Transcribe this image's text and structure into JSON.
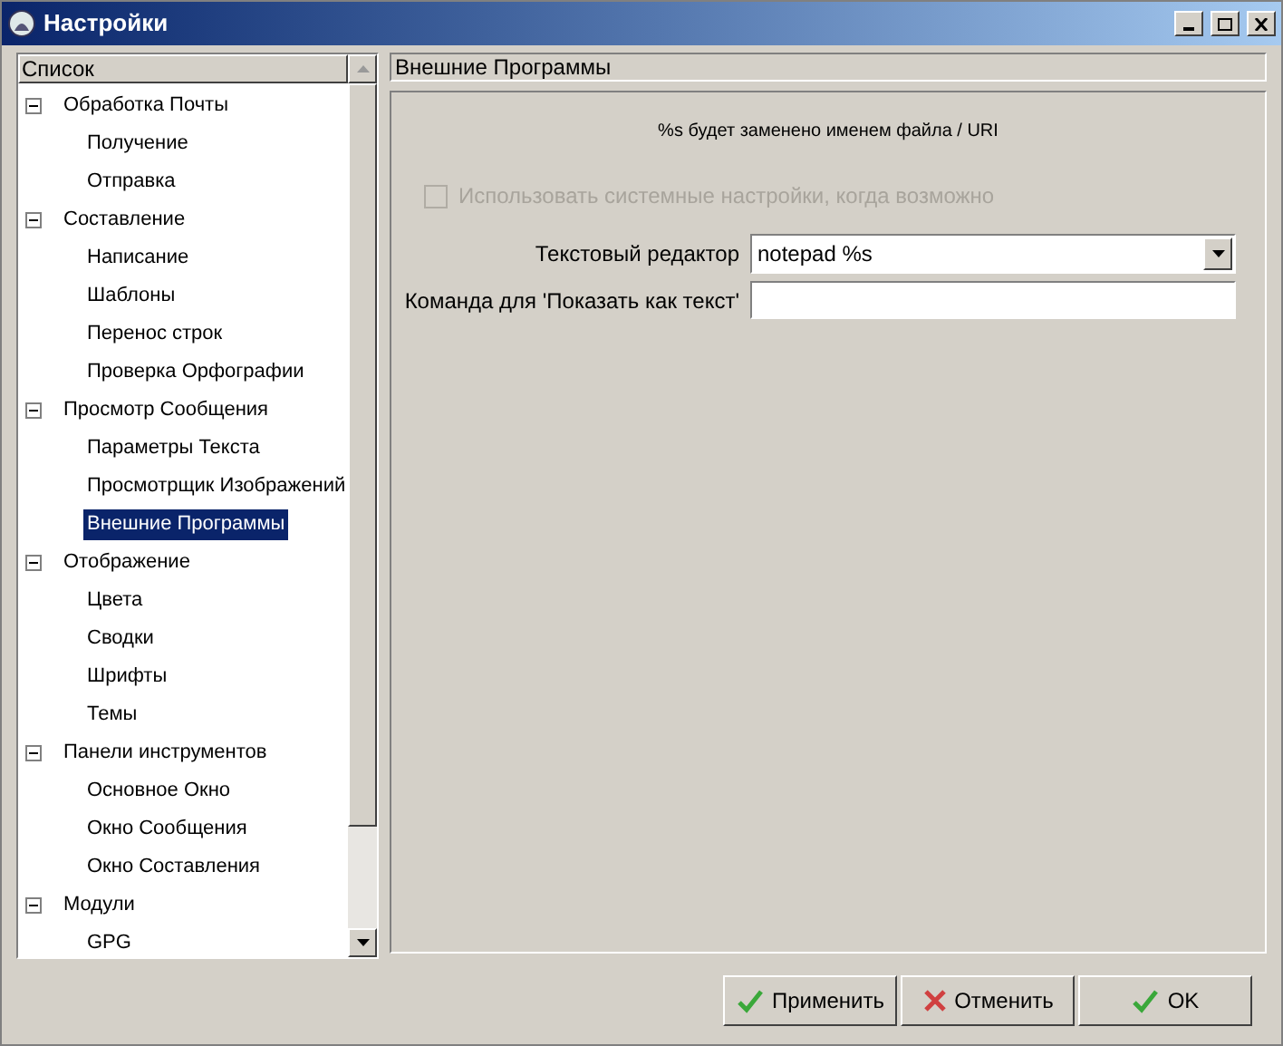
{
  "window": {
    "title": "Настройки"
  },
  "tree": {
    "header": "Список",
    "items": [
      {
        "label": "Обработка Почты",
        "expanded": true,
        "selected": false,
        "children": [
          {
            "label": "Получение",
            "selected": false
          },
          {
            "label": "Отправка",
            "selected": false
          }
        ]
      },
      {
        "label": "Составление",
        "expanded": true,
        "selected": false,
        "children": [
          {
            "label": "Написание",
            "selected": false
          },
          {
            "label": "Шаблоны",
            "selected": false
          },
          {
            "label": "Перенос строк",
            "selected": false
          },
          {
            "label": "Проверка Орфографии",
            "selected": false
          }
        ]
      },
      {
        "label": "Просмотр Сообщения",
        "expanded": true,
        "selected": false,
        "children": [
          {
            "label": "Параметры Текста",
            "selected": false
          },
          {
            "label": "Просмотрщик Изображений",
            "selected": false
          },
          {
            "label": "Внешние Программы",
            "selected": true
          }
        ]
      },
      {
        "label": "Отображение",
        "expanded": true,
        "selected": false,
        "children": [
          {
            "label": "Цвета",
            "selected": false
          },
          {
            "label": "Сводки",
            "selected": false
          },
          {
            "label": "Шрифты",
            "selected": false
          },
          {
            "label": "Темы",
            "selected": false
          }
        ]
      },
      {
        "label": "Панели инструментов",
        "expanded": true,
        "selected": false,
        "children": [
          {
            "label": "Основное Окно",
            "selected": false
          },
          {
            "label": "Окно Сообщения",
            "selected": false
          },
          {
            "label": "Окно Составления",
            "selected": false
          }
        ]
      },
      {
        "label": "Модули",
        "expanded": true,
        "selected": false,
        "children": [
          {
            "label": "GPG",
            "selected": false
          }
        ]
      }
    ]
  },
  "page": {
    "title": "Внешние Программы",
    "note": "%s будет заменено именем файла / URI",
    "use_system": {
      "label": "Использовать системные настройки, когда возможно",
      "checked": false,
      "disabled": true
    },
    "text_editor": {
      "label": "Текстовый редактор",
      "value": "notepad %s"
    },
    "show_as_text": {
      "label": "Команда для 'Показать как текст'"
    }
  },
  "buttons": [
    {
      "label": "Применить",
      "kind": "apply"
    },
    {
      "label": "Отменить",
      "kind": "cancel"
    },
    {
      "label": "OK",
      "kind": "ok"
    }
  ]
}
